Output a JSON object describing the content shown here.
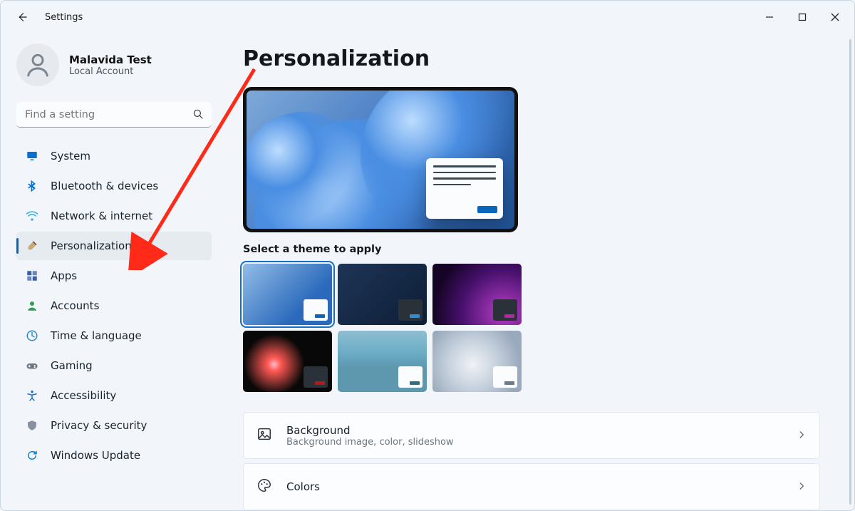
{
  "window": {
    "app_title": "Settings",
    "min_label": "Minimize",
    "max_label": "Maximize",
    "close_label": "Close"
  },
  "user": {
    "name": "Malavida Test",
    "account_type": "Local Account"
  },
  "search": {
    "placeholder": "Find a setting"
  },
  "nav": [
    {
      "id": "system",
      "label": "System",
      "icon": "monitor-icon",
      "color": "#0a6ed1"
    },
    {
      "id": "bluetooth",
      "label": "Bluetooth & devices",
      "icon": "bluetooth-icon",
      "color": "#0a6ed1"
    },
    {
      "id": "network",
      "label": "Network & internet",
      "icon": "wifi-icon",
      "color": "#118ae0"
    },
    {
      "id": "personalization",
      "label": "Personalization",
      "icon": "brush-icon",
      "color": "#7d6a52",
      "active": true
    },
    {
      "id": "apps",
      "label": "Apps",
      "icon": "apps-icon",
      "color": "#3a5fa2"
    },
    {
      "id": "accounts",
      "label": "Accounts",
      "icon": "person-icon",
      "color": "#2f9c54"
    },
    {
      "id": "time",
      "label": "Time & language",
      "icon": "globe-clock-icon",
      "color": "#2f88c4"
    },
    {
      "id": "gaming",
      "label": "Gaming",
      "icon": "game-icon",
      "color": "#6f7984"
    },
    {
      "id": "accessibility",
      "label": "Accessibility",
      "icon": "accessibility-icon",
      "color": "#1b71c8"
    },
    {
      "id": "privacy",
      "label": "Privacy & security",
      "icon": "shield-icon",
      "color": "#8991a1"
    },
    {
      "id": "update",
      "label": "Windows Update",
      "icon": "update-icon",
      "color": "#0f85d0"
    }
  ],
  "page": {
    "title": "Personalization",
    "theme_label": "Select a theme to apply",
    "themes": [
      {
        "id": "light-bloom",
        "selected": true,
        "accent": "#0a66bb"
      },
      {
        "id": "dark-bloom",
        "selected": false,
        "accent": "#2c8fd6"
      },
      {
        "id": "glow",
        "selected": false,
        "accent": "#b228a4"
      },
      {
        "id": "captured",
        "selected": false,
        "accent": "#b3191a"
      },
      {
        "id": "sunrise",
        "selected": false,
        "accent": "#2c6f80"
      },
      {
        "id": "flow",
        "selected": false,
        "accent": "#6d7a89"
      }
    ],
    "cards": [
      {
        "id": "background",
        "title": "Background",
        "subtitle": "Background image, color, slideshow",
        "icon": "picture-icon"
      },
      {
        "id": "colors",
        "title": "Colors",
        "subtitle": "",
        "icon": "palette-icon"
      }
    ]
  }
}
